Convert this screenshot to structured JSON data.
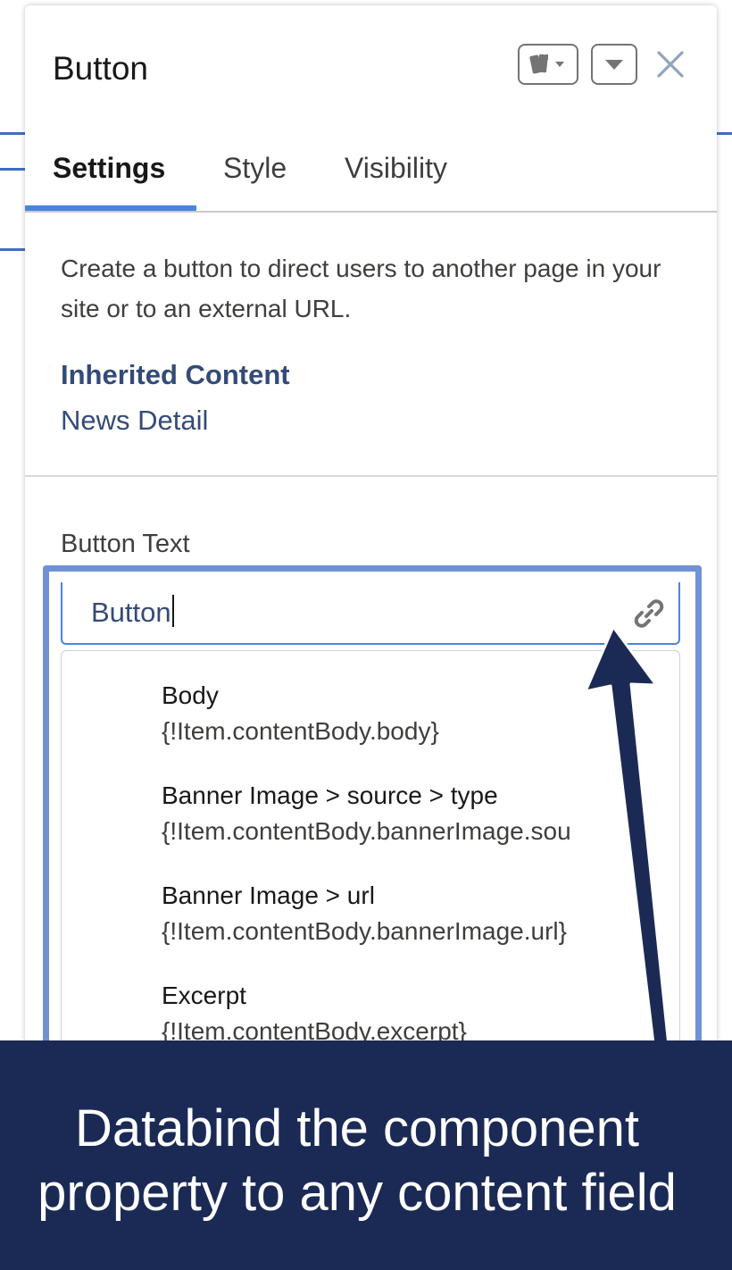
{
  "panel": {
    "title": "Button",
    "header_icons": [
      "variants-icon",
      "chevron-down-icon",
      "close-icon"
    ]
  },
  "tabs": [
    {
      "label": "Settings",
      "active": true
    },
    {
      "label": "Style",
      "active": false
    },
    {
      "label": "Visibility",
      "active": false
    }
  ],
  "description": "Create a button to direct users to another page in your site or to an external URL.",
  "inherited": {
    "heading": "Inherited Content",
    "value": "News Detail"
  },
  "field": {
    "label": "Button Text",
    "value": "Button",
    "icon": "link-icon"
  },
  "dropdown": {
    "items": [
      {
        "label": "Body",
        "expression": "{!Item.contentBody.body}"
      },
      {
        "label": "Banner Image > source > type",
        "expression": "{!Item.contentBody.bannerImage.sou"
      },
      {
        "label": "Banner Image > url",
        "expression": "{!Item.contentBody.bannerImage.url}"
      },
      {
        "label": "Excerpt",
        "expression": "{!Item.contentBody.excerpt}"
      }
    ]
  },
  "caption": {
    "line1": "Databind the component",
    "line2": "property to any content field"
  },
  "colors": {
    "accent": "#4a86d8",
    "link_text": "#344b78",
    "caption_bg": "#1b2a55",
    "focus_ring": "#7092d5"
  }
}
